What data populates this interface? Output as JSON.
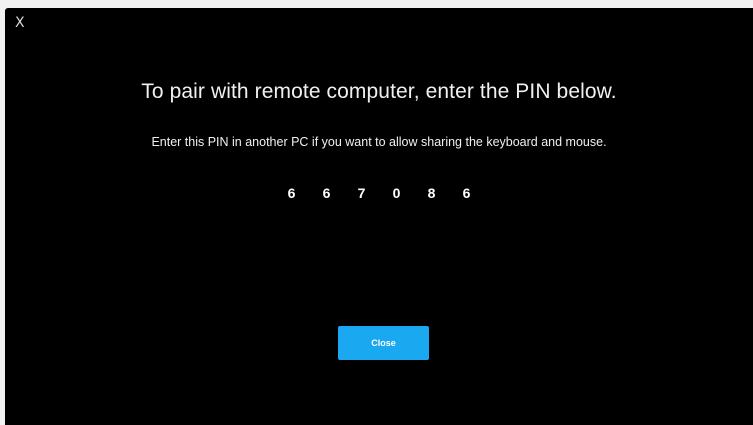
{
  "dialog": {
    "close_glyph": "X",
    "title": "To pair with remote computer, enter the PIN below.",
    "instruction": "Enter this PIN in another PC if you want to allow sharing the keyboard and mouse.",
    "pin_digits": [
      "6",
      "6",
      "7",
      "0",
      "8",
      "6"
    ],
    "close_button_label": "Close"
  },
  "colors": {
    "background": "#000000",
    "accent": "#1aa8f0",
    "text": "#f0f0f0"
  }
}
